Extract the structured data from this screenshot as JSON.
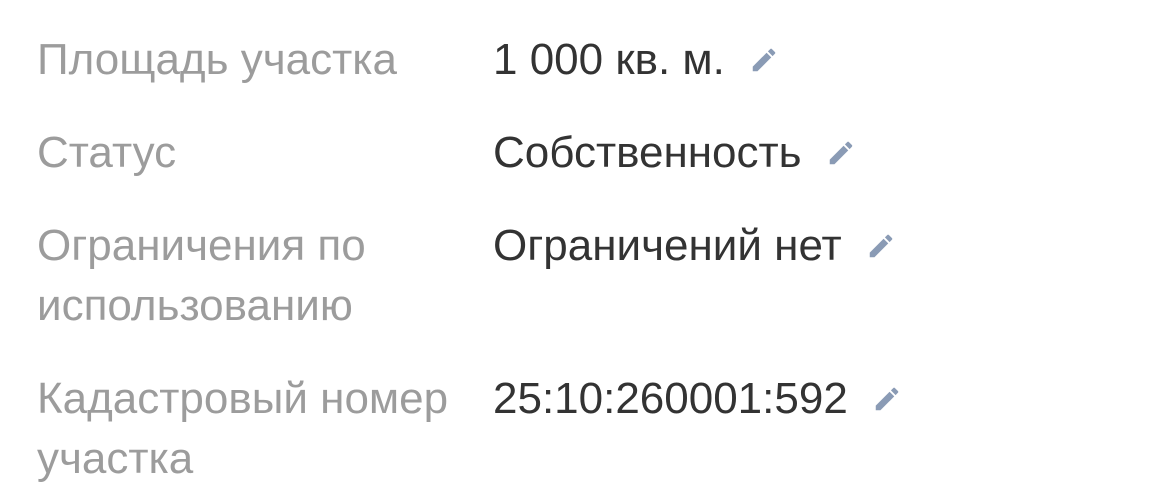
{
  "properties": [
    {
      "label": "Площадь участка",
      "value": "1 000 кв. м."
    },
    {
      "label": "Статус",
      "value": "Собственность"
    },
    {
      "label": "Ограничения по использованию",
      "value": "Ограничений нет"
    },
    {
      "label": "Кадастровый номер участка",
      "value": "25:10:260001:592"
    }
  ],
  "colors": {
    "label": "#9c9c9c",
    "value": "#333333",
    "edit_icon": "#8a9bb5"
  },
  "icons": {
    "edit": "pencil-icon"
  }
}
